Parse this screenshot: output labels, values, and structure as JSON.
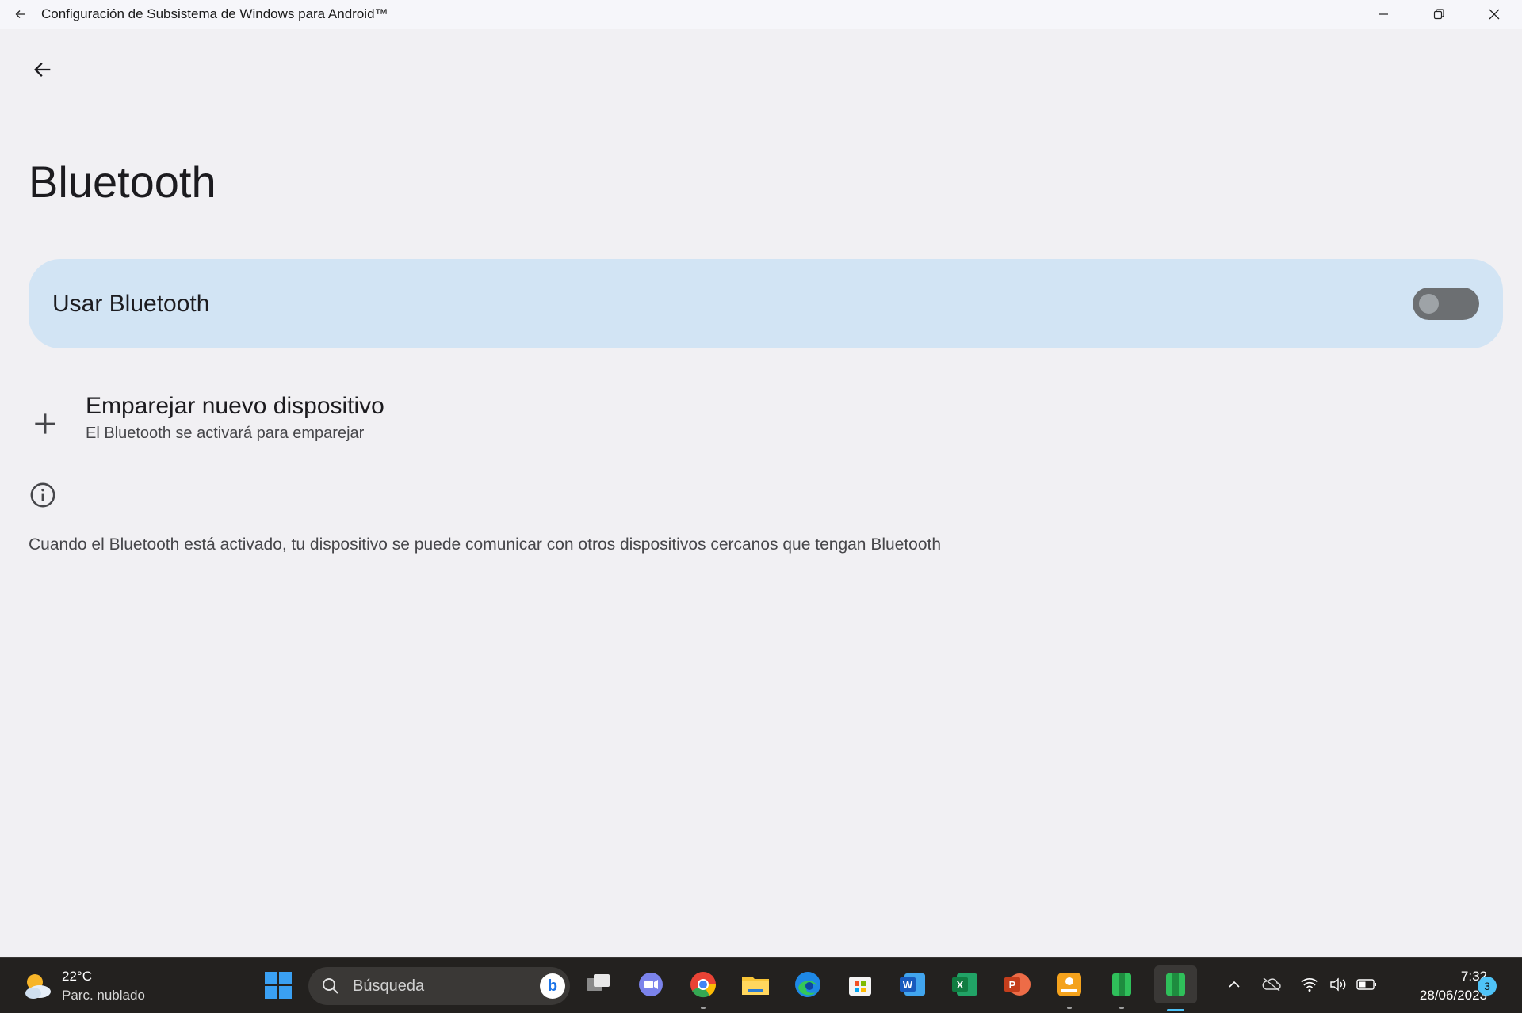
{
  "window": {
    "title": "Configuración de Subsistema de Windows para Android™"
  },
  "page": {
    "title": "Bluetooth",
    "toggle": {
      "label": "Usar Bluetooth",
      "state": "off"
    },
    "pair": {
      "title": "Emparejar nuevo dispositivo",
      "subtitle": "El Bluetooth se activará para emparejar"
    },
    "info_text": "Cuando el Bluetooth está activado, tu dispositivo se puede comunicar con otros dispositivos cercanos que tengan Bluetooth"
  },
  "taskbar": {
    "weather": {
      "temp": "22°C",
      "desc": "Parc. nublado"
    },
    "search_placeholder": "Búsqueda",
    "apps": [
      {
        "name": "task-view",
        "color": "#8a8a8a"
      },
      {
        "name": "teams-chat",
        "color": "#7b83eb"
      },
      {
        "name": "chrome",
        "color": "#ea4335"
      },
      {
        "name": "file-explorer",
        "color": "#f8c537"
      },
      {
        "name": "edge",
        "color": "#1e88e5"
      },
      {
        "name": "microsoft-store",
        "color": "#f25022"
      },
      {
        "name": "word",
        "color": "#185abd"
      },
      {
        "name": "excel",
        "color": "#107c41"
      },
      {
        "name": "powerpoint",
        "color": "#c43e1c"
      },
      {
        "name": "app-orange",
        "color": "#f4a21c"
      },
      {
        "name": "android-settings",
        "color": "#2fbf5a"
      },
      {
        "name": "android-settings-active",
        "color": "#2fbf5a"
      }
    ],
    "clock": {
      "time": "7:32",
      "date": "28/06/2023"
    },
    "notification_count": "3"
  }
}
